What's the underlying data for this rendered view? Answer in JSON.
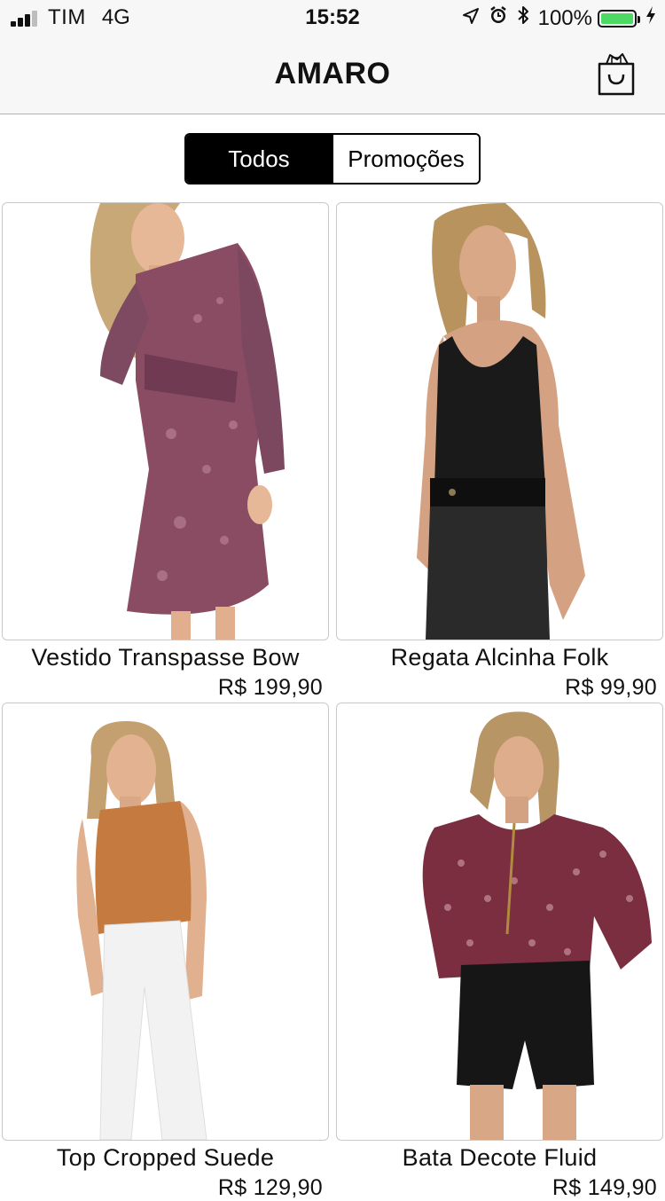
{
  "status_bar": {
    "carrier": "TIM",
    "network": "4G",
    "time": "15:52",
    "battery_percent": "100%",
    "battery_level": 1.0,
    "signal_bars": 3
  },
  "nav": {
    "title": "AMARO",
    "cart_icon": "shopping-bag-icon"
  },
  "segment": {
    "options": [
      "Todos",
      "Promoções"
    ],
    "selected": "Todos"
  },
  "colors": {
    "accent": "#000000",
    "bar_background": "#f7f7f7",
    "battery": "#4cd964"
  },
  "products": [
    {
      "name": "Vestido Transpasse Bow",
      "price": "R$ 199,90"
    },
    {
      "name": "Regata Alcinha Folk",
      "price": "R$ 99,90"
    },
    {
      "name": "Top Cropped Suede",
      "price": "R$ 129,90"
    },
    {
      "name": "Bata Decote Fluid",
      "price": "R$ 149,90"
    }
  ]
}
